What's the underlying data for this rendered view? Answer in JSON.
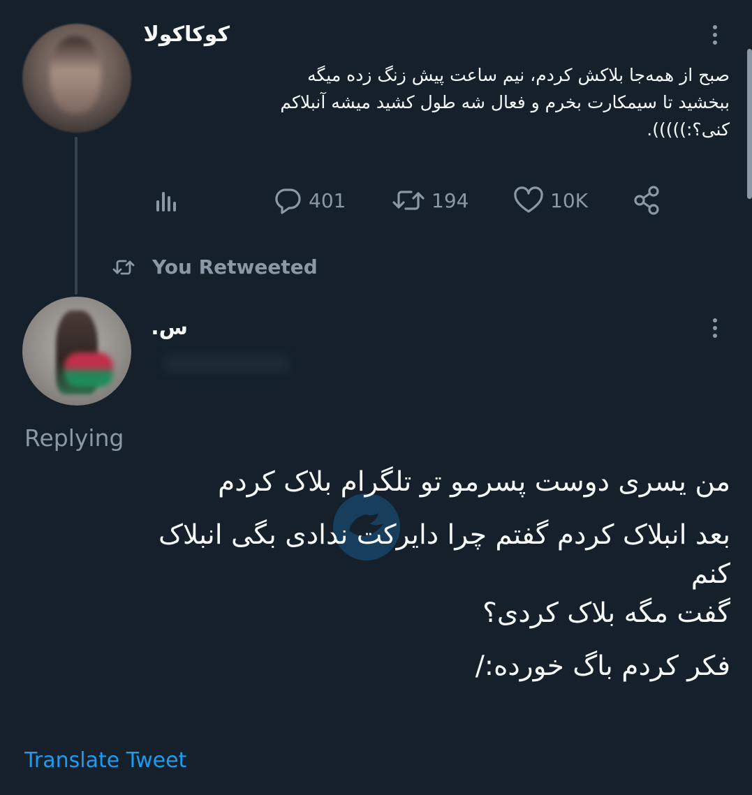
{
  "tweet1": {
    "author_name": "کوکاکولا",
    "text_lines": [
      "صبح از همه‌جا بلاکش کردم، نیم ساعت پیش زنگ زده میگه",
      "ببخشید تا سیمکارت بخرم و فعال شه طول کشید میشه آنبلاکم",
      "کنی؟:)))))."
    ],
    "actions": {
      "reply_count": "401",
      "retweet_count": "194",
      "like_count": "10K"
    }
  },
  "retweet_notice": "You Retweeted",
  "tweet2": {
    "author_name": "س.",
    "replying_label": "Replying",
    "text_lines": [
      "من یسری دوست پسرمو تو تلگرام بلاک کردم",
      "بعد انبلاک کردم گفتم چرا دایرکت ندادی بگی انبلاک",
      "کنم",
      "گفت مگه بلاک کردی؟",
      "فکر کردم باگ خورده:/"
    ],
    "translate_label": "Translate Tweet"
  },
  "colors": {
    "background": "#15202b",
    "text": "#f7f9f9",
    "muted": "#8b98a5",
    "link": "#1d9bf0"
  }
}
